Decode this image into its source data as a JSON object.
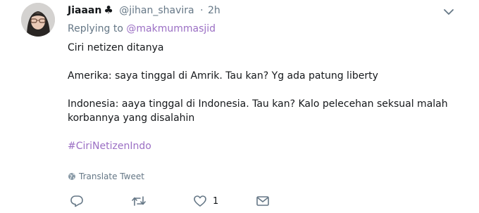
{
  "user": {
    "name": "Jiaaan",
    "handle": "@jihan_shavira",
    "separator": "·",
    "time": "2h"
  },
  "reply": {
    "prefix": "Replying to",
    "mention": "@makmummasjid"
  },
  "text": {
    "line1": "Ciri netizen ditanya",
    "line2": "Amerika: saya tinggal di Amrik. Tau kan? Yg ada patung liberty",
    "line3": "Indonesia: aaya tinggal di Indonesia. Tau kan? Kalo pelecehan seksual malah",
    "line4": "korbannya yang disalahin",
    "hashtag": "#CiriNetizenIndo"
  },
  "translate_label": "Translate Tweet",
  "actions": {
    "like_count": "1"
  },
  "colors": {
    "accent": "#9b6fc4",
    "muted": "#657786",
    "text": "#14171a"
  },
  "icons": [
    "club-icon",
    "chevron-down-icon",
    "globe-icon",
    "reply-icon",
    "retweet-icon",
    "like-icon",
    "message-icon"
  ]
}
